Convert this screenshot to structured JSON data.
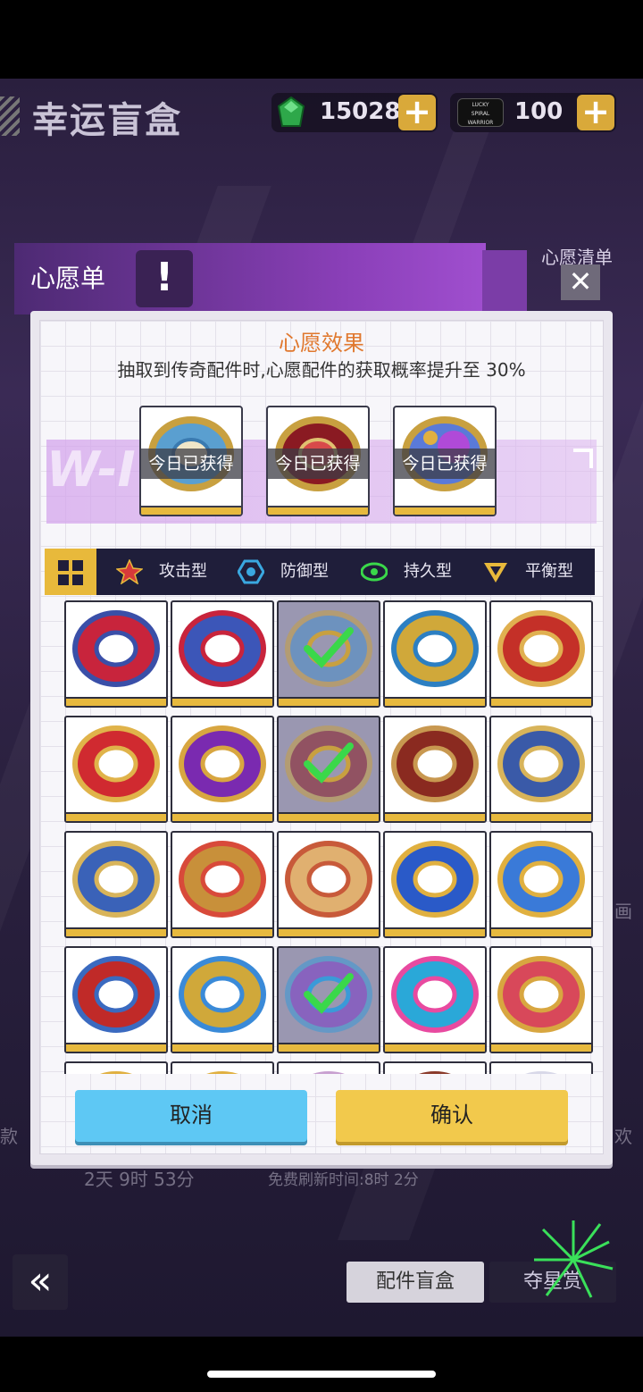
{
  "screen": {
    "title": "幸运盲盒"
  },
  "currencies": [
    {
      "icon": "green-gem-icon",
      "amount": "15028"
    },
    {
      "icon": "lucky-spiral-warrior-ticket-icon",
      "logo_text": "LUCKY SPIRAL WARRIOR",
      "amount": "100"
    }
  ],
  "wish_dialog": {
    "header_title": "心愿单",
    "info_mark": "!",
    "side_label": "心愿清单",
    "close_glyph": "✕",
    "effect_title": "心愿效果",
    "effect_description": "抽取到传奇配件时,心愿配件的获取概率提升至 30%",
    "wish_slots": [
      {
        "name": "blue-gold-part",
        "status": "今日已获得"
      },
      {
        "name": "red-gold-part",
        "status": "今日已获得"
      },
      {
        "name": "purple-gem-part",
        "status": "今日已获得"
      }
    ],
    "filters": [
      {
        "id": "all",
        "label": "",
        "icon": "grid-icon"
      },
      {
        "id": "attack",
        "label": "攻击型",
        "icon": "attack-star-icon"
      },
      {
        "id": "defense",
        "label": "防御型",
        "icon": "defense-hex-icon"
      },
      {
        "id": "stamina",
        "label": "持久型",
        "icon": "stamina-eye-icon"
      },
      {
        "id": "balance",
        "label": "平衡型",
        "icon": "balance-triangle-icon"
      }
    ],
    "cancel_label": "取消",
    "confirm_label": "确认"
  },
  "parts_grid": [
    {
      "colors": [
        "#c8243c",
        "#3a4fa8"
      ],
      "selected": false
    },
    {
      "colors": [
        "#3c56b8",
        "#c8243c"
      ],
      "selected": false
    },
    {
      "colors": [
        "#4a8fc8",
        "#c8a040"
      ],
      "selected": true
    },
    {
      "colors": [
        "#d0a83a",
        "#2c7fc2"
      ],
      "selected": false
    },
    {
      "colors": [
        "#c43028",
        "#e0b050"
      ],
      "selected": false
    },
    {
      "colors": [
        "#d02a30",
        "#e0b34a"
      ],
      "selected": false
    },
    {
      "colors": [
        "#7a2ab0",
        "#d8a640"
      ],
      "selected": false
    },
    {
      "colors": [
        "#8a1a22",
        "#c8a040"
      ],
      "selected": true
    },
    {
      "colors": [
        "#8a2a20",
        "#c89850"
      ],
      "selected": false
    },
    {
      "colors": [
        "#3a5aa8",
        "#d8b45a"
      ],
      "selected": false
    },
    {
      "colors": [
        "#3a62b8",
        "#d8b45a"
      ],
      "selected": false
    },
    {
      "colors": [
        "#c8903a",
        "#d84a3a"
      ],
      "selected": false
    },
    {
      "colors": [
        "#e0b070",
        "#c85a3a"
      ],
      "selected": false
    },
    {
      "colors": [
        "#2a5ac8",
        "#e0b040"
      ],
      "selected": false
    },
    {
      "colors": [
        "#3a7ad8",
        "#e0b040"
      ],
      "selected": false
    },
    {
      "colors": [
        "#c02a28",
        "#3a6ac0"
      ],
      "selected": false
    },
    {
      "colors": [
        "#d0a83a",
        "#3a8ad8"
      ],
      "selected": false
    },
    {
      "colors": [
        "#7a3ac8",
        "#3a9ad8"
      ],
      "selected": true
    },
    {
      "colors": [
        "#2aa8d8",
        "#e84aa0"
      ],
      "selected": false
    },
    {
      "colors": [
        "#d8485a",
        "#d8a640"
      ],
      "selected": false
    },
    {
      "colors": [
        "#3a9ac8",
        "#e0b040"
      ],
      "selected": false
    },
    {
      "colors": [
        "#d0b090",
        "#e0b040"
      ],
      "selected": false
    },
    {
      "colors": [
        "#8a6ab8",
        "#c8a0d0"
      ],
      "selected": false
    },
    {
      "colors": [
        "#c84a3a",
        "#8a3a2a"
      ],
      "selected": false
    },
    {
      "colors": [
        "#3a8ad8",
        "#d8d8e8"
      ],
      "selected": false
    }
  ],
  "background": {
    "left_edge_text": "款",
    "right_edge_text": "画",
    "right_edge_text_2": "欢",
    "timer_text": "2天 9时 53分",
    "refresh_text": "免费刷新时间:8时 2分",
    "tabs": [
      {
        "label": "配件盲盒",
        "active": true
      },
      {
        "label": "夺星赏",
        "active": false
      }
    ]
  },
  "colors": {
    "accent_gold": "#e8b93b",
    "cancel_blue": "#5ec8f4",
    "confirm_yellow": "#f2c94c",
    "effect_orange": "#e0782e",
    "filter_bar_navy": "#1f1e3a"
  }
}
